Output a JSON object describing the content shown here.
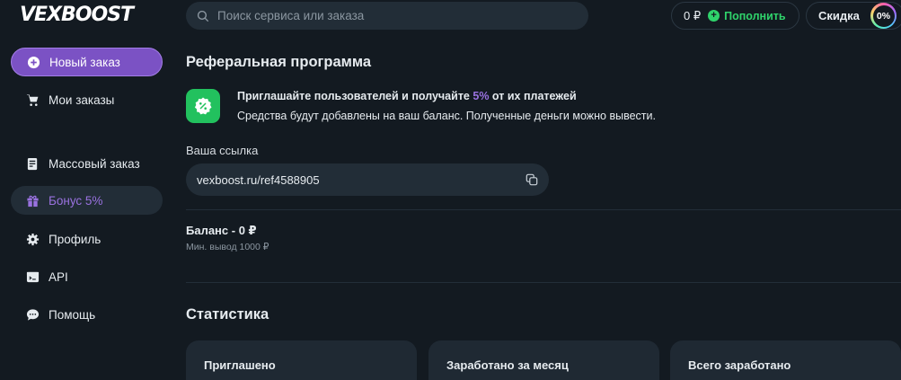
{
  "logo": "VEXBOOST",
  "search": {
    "placeholder": "Поиск сервиса или заказа"
  },
  "header": {
    "balance": "0 ₽",
    "topup_label": "Пополнить",
    "discount_label": "Скидка",
    "discount_value": "0%"
  },
  "sidebar": {
    "items": [
      {
        "label": "Новый заказ",
        "icon": "plus-circle-icon"
      },
      {
        "label": "Мои заказы",
        "icon": "cart-icon"
      },
      {
        "label": "Массовый заказ",
        "icon": "list-icon"
      },
      {
        "label": "Бонус 5%",
        "icon": "gift-icon"
      },
      {
        "label": "Профиль",
        "icon": "gear-icon"
      },
      {
        "label": "API",
        "icon": "terminal-icon"
      },
      {
        "label": "Помощь",
        "icon": "chat-icon"
      }
    ]
  },
  "main": {
    "title": "Реферальная программа",
    "promo_prefix": "Приглашайте пользователей и получайте ",
    "promo_percent": "5%",
    "promo_suffix": " от их платежей",
    "promo_line2": "Средства будут добавлены на ваш баланс. Полученные деньги можно вывести.",
    "link_label": "Ваша ссылка",
    "link_value": "vexboost.ru/ref4588905",
    "balance_title": "Баланс - 0 ₽",
    "balance_sub": "Мин. вывод 1000 ₽",
    "stats_title": "Статистика",
    "stats": [
      {
        "label": "Приглашено"
      },
      {
        "label": "Заработано за месяц"
      },
      {
        "label": "Всего заработано"
      }
    ]
  },
  "colors": {
    "background": "#131a21",
    "accent_purple": "#7b52c4",
    "accent_green": "#2fd36b",
    "surface": "#222d37"
  }
}
